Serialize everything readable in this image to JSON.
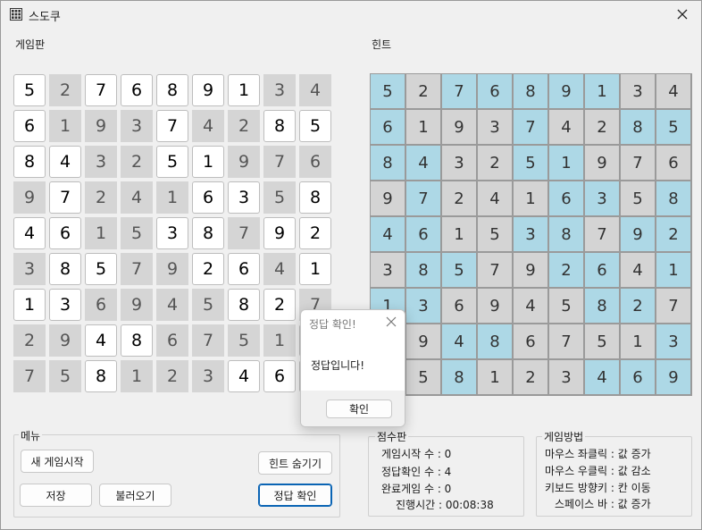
{
  "window": {
    "title": "스도쿠",
    "icon": "grid-icon",
    "close_icon": "close-icon"
  },
  "board": {
    "label": "게임판",
    "values": [
      [
        5,
        2,
        7,
        6,
        8,
        9,
        1,
        3,
        4
      ],
      [
        6,
        1,
        9,
        3,
        7,
        4,
        2,
        8,
        5
      ],
      [
        8,
        4,
        3,
        2,
        5,
        1,
        9,
        7,
        6
      ],
      [
        9,
        7,
        2,
        4,
        1,
        6,
        3,
        5,
        8
      ],
      [
        4,
        6,
        1,
        5,
        3,
        8,
        7,
        9,
        2
      ],
      [
        3,
        8,
        5,
        7,
        9,
        2,
        6,
        4,
        1
      ],
      [
        1,
        3,
        6,
        9,
        4,
        5,
        8,
        2,
        7
      ],
      [
        2,
        9,
        4,
        8,
        6,
        7,
        5,
        1,
        3
      ],
      [
        7,
        5,
        8,
        1,
        2,
        3,
        4,
        6,
        9
      ]
    ],
    "given": [
      [
        0,
        1,
        0,
        0,
        0,
        0,
        0,
        1,
        1
      ],
      [
        0,
        1,
        1,
        1,
        0,
        1,
        1,
        0,
        0
      ],
      [
        0,
        0,
        1,
        1,
        0,
        0,
        1,
        1,
        1
      ],
      [
        1,
        0,
        1,
        1,
        1,
        0,
        0,
        1,
        0
      ],
      [
        0,
        0,
        1,
        1,
        0,
        0,
        1,
        0,
        0
      ],
      [
        1,
        0,
        0,
        1,
        1,
        0,
        0,
        1,
        0
      ],
      [
        0,
        0,
        1,
        1,
        1,
        1,
        0,
        0,
        1
      ],
      [
        1,
        1,
        0,
        0,
        1,
        1,
        1,
        1,
        0
      ],
      [
        1,
        1,
        0,
        1,
        1,
        1,
        0,
        0,
        0
      ]
    ]
  },
  "hint": {
    "label": "힌트"
  },
  "menu": {
    "title": "메뉴",
    "new_game": "새 게임시작",
    "hide_hint": "힌트 숨기기",
    "save": "저장",
    "load": "불러오기",
    "check": "정답 확인"
  },
  "score": {
    "title": "점수판",
    "games_started": "게임시작 수 : 0",
    "checks": "정답확인 수 : 4",
    "completed": "완료게임 수 : 0",
    "elapsed": "진행시간 : 00:08:38"
  },
  "howto": {
    "title": "게임방법",
    "lines": [
      "마우스 좌클릭 : 값 증가",
      "마우스 우클릭 : 값 감소",
      "키보드 방향키 : 칸 이동",
      "스페이스 바 : 값 증가"
    ]
  },
  "dialog": {
    "title": "정답 확인!",
    "message": "정답입니다!",
    "ok": "확인"
  },
  "colors": {
    "given_cell": "#d5d5d5",
    "entered_cell": "#ffffff",
    "hint_given": "#d4d4d4",
    "hint_entered": "#add8e6",
    "accent": "#0a64b4"
  }
}
